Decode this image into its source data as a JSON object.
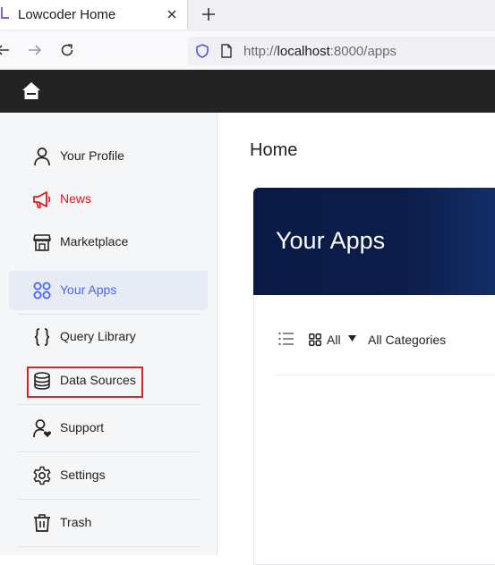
{
  "browser": {
    "tab_title": "Lowcoder Home",
    "url_scheme": "http://",
    "url_host": "localhost",
    "url_rest": ":8000/apps"
  },
  "sidebar": {
    "items": [
      {
        "label": "Your Profile",
        "icon": "user-icon"
      },
      {
        "label": "News",
        "icon": "megaphone-icon"
      },
      {
        "label": "Marketplace",
        "icon": "store-icon"
      },
      {
        "label": "Your Apps",
        "icon": "apps-grid-icon"
      },
      {
        "label": "Query Library",
        "icon": "braces-icon"
      },
      {
        "label": "Data Sources",
        "icon": "database-icon"
      },
      {
        "label": "Support",
        "icon": "support-user-icon"
      },
      {
        "label": "Settings",
        "icon": "gear-icon"
      },
      {
        "label": "Trash",
        "icon": "trash-icon"
      }
    ],
    "active": "Your Apps"
  },
  "main": {
    "title": "Home",
    "banner_title": "Your Apps",
    "filter_all": "All",
    "filter_categories": "All Categories"
  },
  "colors": {
    "accent": "#4965f2",
    "news": "#e5161a",
    "highlight": "#d8232a",
    "header": "#232323",
    "banner": "#0a1a45"
  }
}
